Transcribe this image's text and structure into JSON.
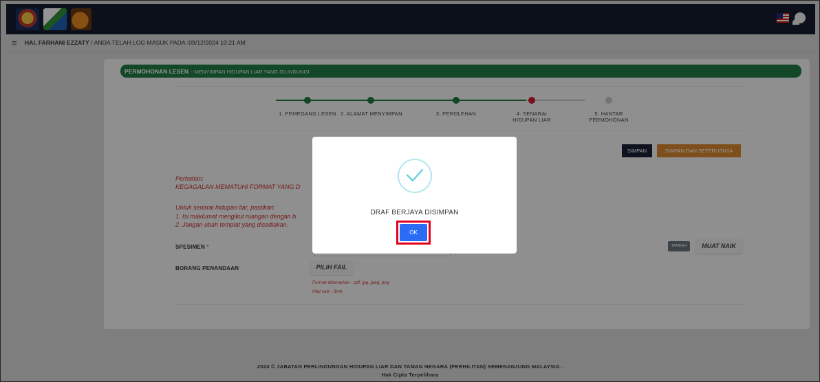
{
  "header": {
    "welcome_name": "HAI, FARHANI EZZATY",
    "welcome_rest": " / ANDA TELAH LOG MASUK PADA :09/12/2024 10:21 AM"
  },
  "card": {
    "title": "PERMOHONAN LESEN",
    "subtitle": "- MENYIMPAN HIDUPAN LIAR YANG DILINDUNGI"
  },
  "steps": [
    {
      "label": "1. PEMEGANG LESEN",
      "status": "done"
    },
    {
      "label": "2. ALAMAT MENYIMPAN",
      "status": "done"
    },
    {
      "label": "3. PEROLEHAN",
      "status": "done"
    },
    {
      "label": "4. SENARAI HIDUPAN LIAR",
      "status": "current"
    },
    {
      "label": "5. HANTAR PERMOHONAN",
      "status": "pending"
    }
  ],
  "buttons": {
    "simpan": "SIMPAN",
    "simpan_seterusnya": "SIMPAN DAN SETERUSNYA",
    "tambah": "TAMBAH",
    "muat_naik": "MUAT NAIK",
    "pilih_fail": "PILIH FAIL"
  },
  "notice": {
    "heading": "Perhatian:",
    "warning": "KEGAGALAN MEMATUHI FORMAT YANG D",
    "intro": "Untuk senarai hidupan liar, pastikan:",
    "item1": "1. Isi maklumat mengikut ruangan dengan b",
    "item2": "2. Jangan ubah templat yang disediakan."
  },
  "form": {
    "spesimen_label": "SPESIMEN",
    "required_mark": "*",
    "borang_label": "BORANG PENANDAAN",
    "format_hint": "Format dibenarkan : pdf, jpg, jpeg, png",
    "size_hint": "Had saiz : 3mb"
  },
  "modal": {
    "message": "DRAF BERJAYA DISIMPAN",
    "ok": "OK"
  },
  "footer": {
    "line1": "2024 © JABATAN PERLINDUNGAN HIDUPAN LIAR DAN TAMAN NEGARA (PERHILITAN) SEMENANJUNG MALAYSIA .",
    "line2": "Hak Cipta Terpelihara"
  },
  "colors": {
    "done": "#1e7d3c",
    "current": "#d0182a",
    "pending": "#c9c9c9",
    "title_bar": "#1f7a44",
    "ok_button": "#2b6cf6"
  }
}
